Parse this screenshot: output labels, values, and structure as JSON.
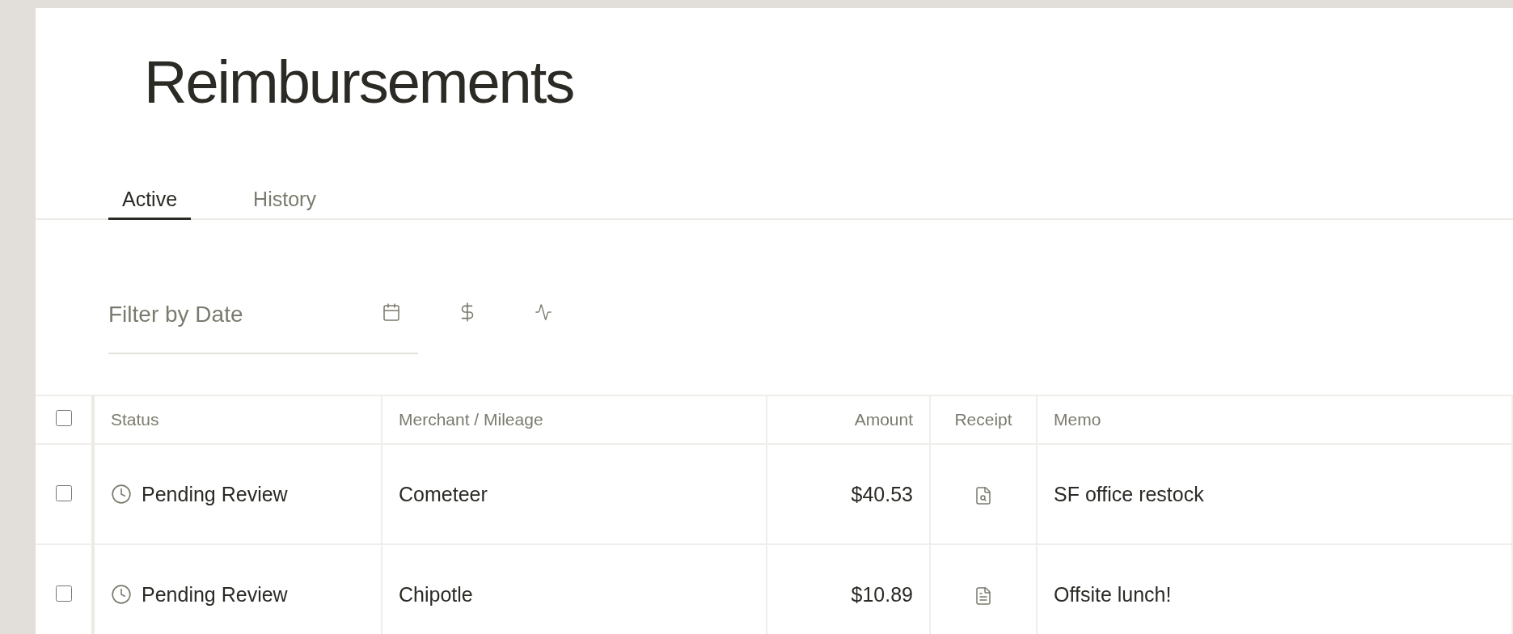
{
  "title": "Reimbursements",
  "tabs": [
    {
      "label": "Active",
      "selected": true
    },
    {
      "label": "History",
      "selected": false
    }
  ],
  "filter": {
    "placeholder": "Filter by Date"
  },
  "table": {
    "select_all": {
      "checked": false
    },
    "columns": [
      "Status",
      "Merchant / Mileage",
      "Amount",
      "Receipt",
      "Memo"
    ],
    "rows": [
      {
        "checked": false,
        "status": "Pending Review",
        "merchant": "Cometeer",
        "amount": "$40.53",
        "receipt": {
          "kind": "preview"
        },
        "memo": "SF office restock"
      },
      {
        "checked": false,
        "status": "Pending Review",
        "merchant": "Chipotle",
        "amount": "$10.89",
        "receipt": {
          "kind": "document"
        },
        "memo": "Offsite lunch!"
      }
    ]
  }
}
